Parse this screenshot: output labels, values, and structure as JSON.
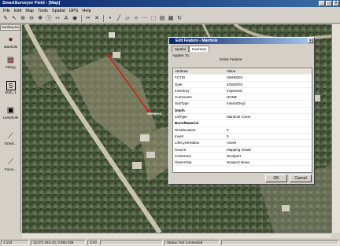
{
  "window": {
    "title": "SmartSurveyor Field - [Map]",
    "controls": [
      "_",
      "□",
      "×"
    ]
  },
  "menu": [
    "File",
    "Edit",
    "Map",
    "Tools",
    "Spatial",
    "GPS",
    "Help"
  ],
  "toolbar": {
    "icons": [
      "pencil-icon",
      "cursor-icon",
      "zoom-in-icon",
      "zoom-out-icon",
      "pan-icon",
      "info-icon",
      "measure-icon",
      "text-icon",
      "gps-icon",
      "cut-icon",
      "delete-icon",
      "point-icon",
      "line-icon",
      "polygon-icon",
      "snap-icon",
      "vertex-icon",
      "select-icon",
      "layer-icon",
      "grid-icon",
      "refresh-icon"
    ],
    "glyphs": [
      "✎",
      "↖",
      "⊕",
      "⊖",
      "✥",
      "ⓘ",
      "⇿",
      "A",
      "◉",
      "✂",
      "✕",
      "•",
      "╱",
      "▱",
      "⊹",
      "⋯",
      "⬚",
      "▤",
      "▦",
      "↻"
    ]
  },
  "sidebar": {
    "tab": "SanitarySe..",
    "items": [
      {
        "label": "Manhole",
        "icon": "manhole-icon",
        "glyph": "●"
      },
      {
        "label": "Fitting",
        "icon": "fitting-icon",
        "glyph": "▦"
      },
      {
        "label": "Stub_1",
        "icon": "stub-icon",
        "glyph": "S"
      },
      {
        "label": "Lamphole",
        "icon": "lamphole-icon",
        "glyph": "▣"
      },
      {
        "label": "Gravit...",
        "icon": "gravity-main-icon",
        "glyph": "⟋"
      },
      {
        "label": "Force...",
        "icon": "force-main-icon",
        "glyph": "⟋"
      }
    ]
  },
  "map": {
    "label": "SMH0003",
    "colors": {
      "forest": "#4c5a3c",
      "road": "#c9c2ad",
      "clearing": "#8c8a6c",
      "line": "#d21a1a"
    }
  },
  "dialog": {
    "title": "Edit Feature - Manhole",
    "tabs": [
      "Spatial",
      "Inventory"
    ],
    "applies_label": "Applies To:",
    "applies_value": "Entire Feature",
    "headers": [
      "Attribute",
      "Value"
    ],
    "rows": [
      {
        "attribute": "FCTID",
        "value": "SMH0003"
      },
      {
        "attribute": "Date",
        "value": "4/28/2003"
      },
      {
        "attribute": "Inventory",
        "value": "Inspected"
      },
      {
        "attribute": "Comments",
        "value": "NONE"
      },
      {
        "attribute": "SubType",
        "value": "InteriorDrop"
      },
      {
        "attribute": "Depth",
        "value": "",
        "section": true
      },
      {
        "attribute": "LidType",
        "value": "Manhole Cover"
      },
      {
        "attribute": "BarrelMaterial",
        "value": "",
        "section": true
      },
      {
        "attribute": "RimElevation",
        "value": "0"
      },
      {
        "attribute": "Invert",
        "value": "0"
      },
      {
        "attribute": "LifeCycleStatus",
        "value": "Active"
      },
      {
        "attribute": "Source",
        "value": "Mapping Grade"
      },
      {
        "attribute": "Contractor",
        "value": "Woolpert"
      },
      {
        "attribute": "Ownership",
        "value": "Newport News"
      }
    ],
    "ok": "OK",
    "cancel": "Cancel"
  },
  "status": {
    "scale": "1:123",
    "coords": "12,071 919.23, 3 550 238",
    "mode": "CAD",
    "connection": "Status: Not Connected"
  }
}
